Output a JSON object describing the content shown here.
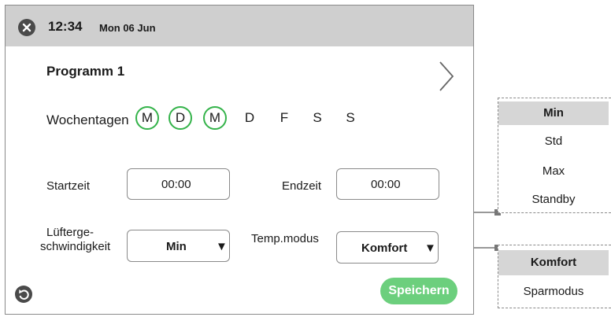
{
  "header": {
    "time": "12:34",
    "date": "Mon 06 Jun"
  },
  "program": {
    "title": "Programm 1"
  },
  "weekdays": {
    "label": "Wochentagen",
    "days": [
      {
        "label": "M",
        "active": true
      },
      {
        "label": "D",
        "active": true
      },
      {
        "label": "M",
        "active": true
      },
      {
        "label": "D",
        "active": false
      },
      {
        "label": "F",
        "active": false
      },
      {
        "label": "S",
        "active": false
      },
      {
        "label": "S",
        "active": false
      }
    ]
  },
  "start": {
    "label": "Startzeit",
    "value": "00:00"
  },
  "end": {
    "label": "Endzeit",
    "value": "00:00"
  },
  "fan": {
    "label_line1": "Lüfterge-",
    "label_line2": "schwindigkeit",
    "value": "Min"
  },
  "temp": {
    "label": "Temp.modus",
    "value": "Komfort"
  },
  "save_label": "Speichern",
  "fan_options": [
    "Min",
    "Std",
    "Max",
    "Standby"
  ],
  "temp_options": [
    "Komfort",
    "Sparmodus"
  ],
  "icons": {
    "close": "close-icon",
    "next": "chevron-right-icon",
    "back": "back-icon",
    "caret": "caret-down-icon"
  },
  "colors": {
    "accent": "#34b34a",
    "save_button": "#6ccf7d",
    "topbar": "#cfcfcf"
  }
}
